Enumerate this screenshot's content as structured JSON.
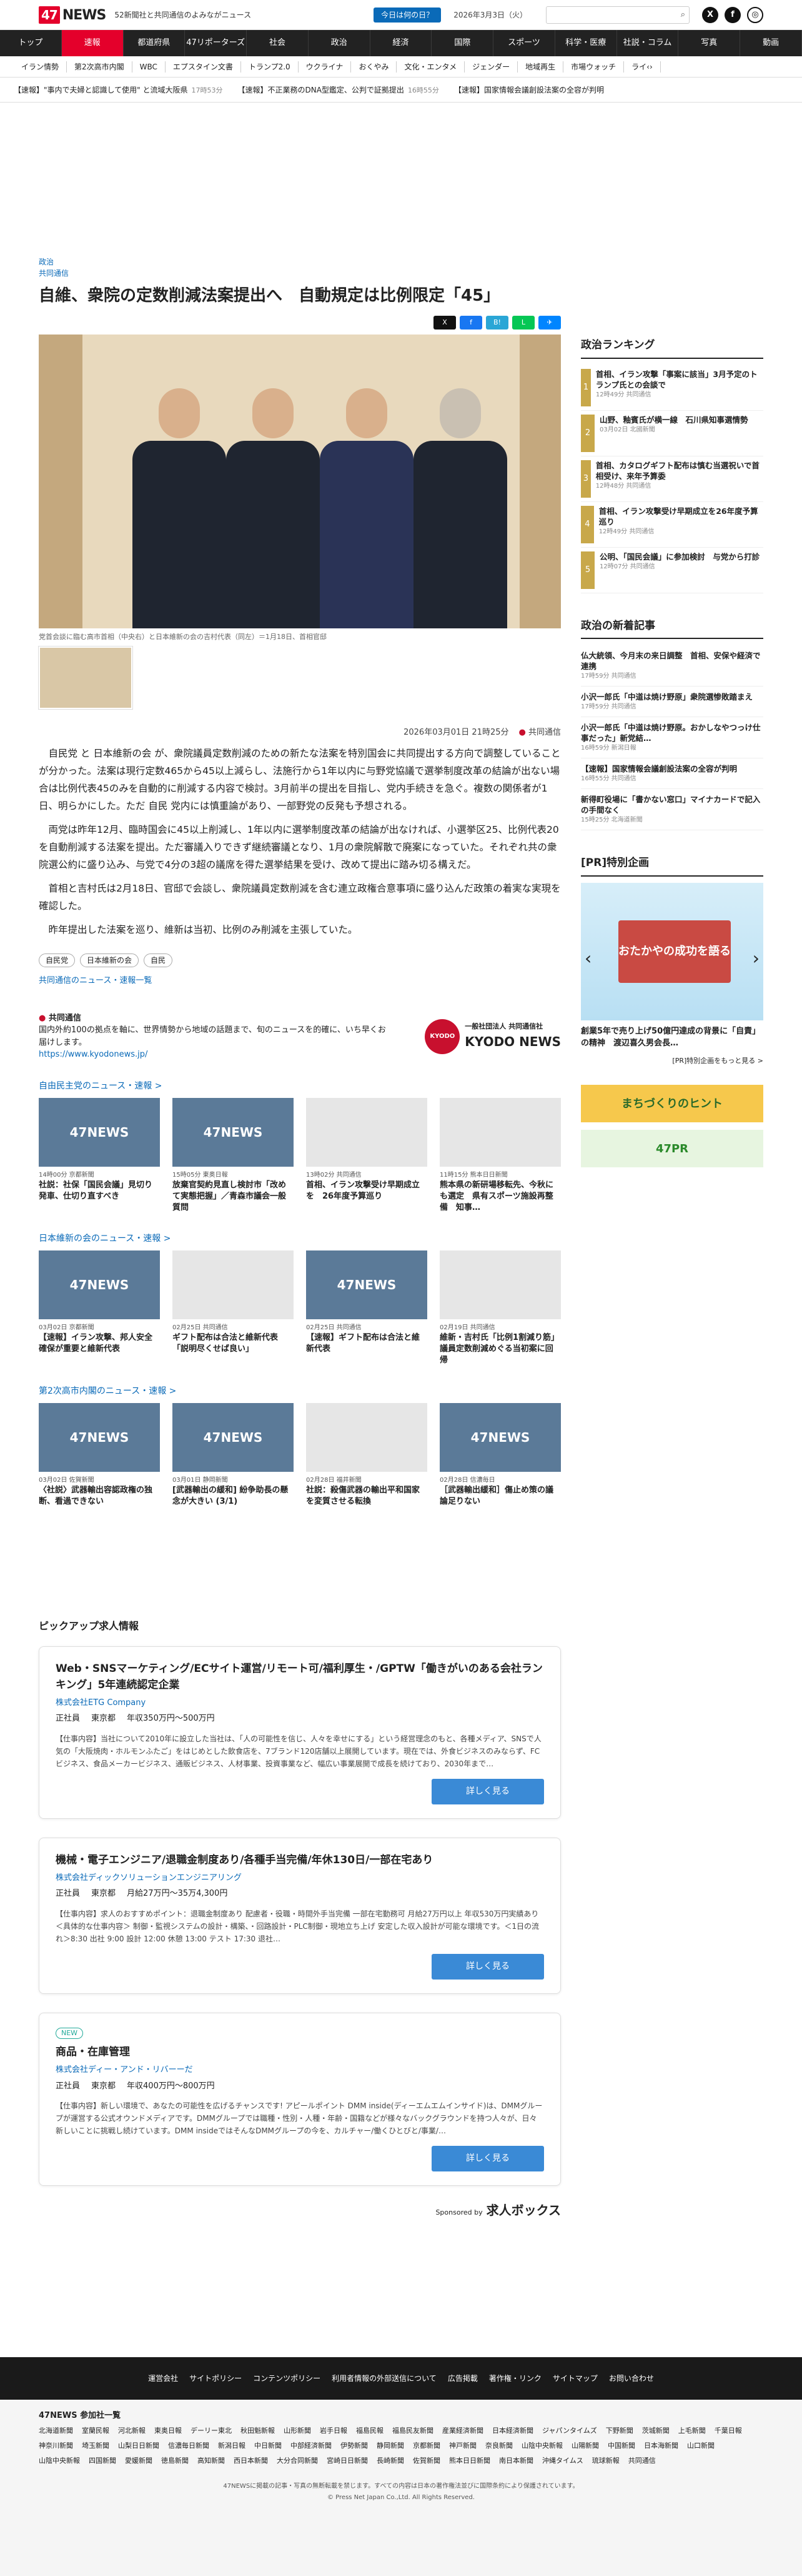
{
  "header": {
    "logo_num": "47",
    "logo_text": "NEWS",
    "tagline": "52新聞社と共同通信のよみながニュース",
    "quiz": "今日は何の日？",
    "date": "2026年3月3日（火）"
  },
  "nav": [
    "トップ",
    "速報",
    "都道府県",
    "47リポーターズ",
    "社会",
    "政治",
    "経済",
    "国際",
    "スポーツ",
    "科学・医療",
    "社説・コラム",
    "写真",
    "動画"
  ],
  "subnav": [
    "イラン情勢",
    "第2次高市内閣",
    "WBC",
    "エプスタイン文書",
    "トランプ2.0",
    "ウクライナ",
    "おくやみ",
    "文化・エンタメ",
    "ジェンダー",
    "地域再生",
    "市場ウォッチ",
    "ライ‹›"
  ],
  "ticker": [
    {
      "t": "【速報】\"事内で夫婦と認識して使用\" と流域大阪県",
      "m": "17時53分"
    },
    {
      "t": "【速報】不正業務のDNA型鑑定、公判で証拠提出",
      "m": "16時55分"
    },
    {
      "t": "【速報】国家情報会議創設法案の全容が判明",
      "m": ""
    }
  ],
  "article": {
    "cat1": "政治",
    "cat2": "共同通信",
    "title": "自維、衆院の定数削減法案提出へ　自動規定は比例限定「45」",
    "caption": "党首会談に臨む高市首相（中央右）と日本維新の会の吉村代表（同左）＝1月18日、首相官邸",
    "datetime": "2026年03月01日 21時25分",
    "source": "共同通信",
    "paras": [
      "自民党 と 日本維新の会 が、衆院議員定数削減のための新たな法案を特別国会に共同提出する方向で調整していることが分かった。法案は現行定数465から45以上減らし、法施行から1年以内に与野党協議で選挙制度改革の結論が出ない場合は比例代表45のみを自動的に削減する内容で検討。3月前半の提出を目指し、党内手続きを急ぐ。複数の関係者が1日、明らかにした。ただ 自民 党内には慎重論があり、一部野党の反発も予想される。",
      "両党は昨年12月、臨時国会に45以上削減し、1年以内に選挙制度改革の結論が出なければ、小選挙区25、比例代表20を自動削減する法案を提出。ただ審議入りできず継続審議となり、1月の衆院解散で廃案になっていた。それぞれ共の衆院選公約に盛り込み、与党で4分の3超の議席を得た選挙結果を受け、改めて提出に踏み切る構えだ。",
      "首相と吉村氏は2月18日、官邸で会談し、衆院議員定数削減を含む連立政権合意事項に盛り込んだ政策の着実な実現を確認した。",
      "昨年提出した法案を巡り、維新は当初、比例のみ削減を主張していた。"
    ],
    "tags": [
      "自民党",
      "日本維新の会",
      "自民"
    ],
    "more": "共同通信のニュース・速報一覧"
  },
  "source_box": {
    "name": "共同通信",
    "desc": "国内外約100の拠点を軸に、世界情勢から地域の話題まで、旬のニュースを的確に、いち早くお届けします。",
    "url": "https://www.kyodonews.jp/",
    "logo_small": "KYODO",
    "logo_jp": "一般社団法人 共同通信社",
    "logo_en": "KYODO NEWS"
  },
  "sections": [
    {
      "title": "自由民主党のニュース・速報 >",
      "items": [
        {
          "d": "14時00分 京都新聞",
          "t": "社説：社保「国民会議」見切り発車、仕切り直すべき",
          "img": "47NEWS"
        },
        {
          "d": "15時05分 東奥日報",
          "t": "放棄官契約見直し検討市「改めて実態把握」／青森市議会一般質問",
          "img": "47NEWS"
        },
        {
          "d": "13時02分 共同通信",
          "t": "首相、イラン攻撃受け早期成立を　26年度予算巡り",
          "img": "photo"
        },
        {
          "d": "11時15分 熊本日日新聞",
          "t": "熊本県の新研場移転先、今秋にも選定　県有スポーツ施設再整備　知事…",
          "img": "photo"
        }
      ]
    },
    {
      "title": "日本維新の会のニュース・速報 >",
      "items": [
        {
          "d": "03月02日 京都新聞",
          "t": "【速報】イラン攻撃、邦人安全確保が重要と維新代表",
          "img": "47NEWS"
        },
        {
          "d": "02月25日 共同通信",
          "t": "ギフト配布は合法と維新代表「説明尽くせば良い」",
          "img": "photo"
        },
        {
          "d": "02月25日 共同通信",
          "t": "【速報】ギフト配布は合法と維新代表",
          "img": "47NEWS"
        },
        {
          "d": "02月19日 共同通信",
          "t": "維新・吉村氏「比例1割減り筋」議員定数削減めぐる当初案に回帰",
          "img": "photo"
        }
      ]
    },
    {
      "title": "第2次高市内閣のニュース・速報 >",
      "items": [
        {
          "d": "03月02日 佐賀新聞",
          "t": "〈社説〉武器輸出容認政権の独断、看過できない",
          "img": "47NEWS"
        },
        {
          "d": "03月01日 静岡新聞",
          "t": "[武器輸出の緩和] 紛争助長の懸念が大きい (3/1)",
          "img": "47NEWS"
        },
        {
          "d": "02月28日 福井新聞",
          "t": "社説：殺傷武器の輸出平和国家を変質させる転換",
          "img": "photo"
        },
        {
          "d": "02月28日 信濃毎日",
          "t": "［武器輸出緩和］傷止め策の議論足りない",
          "img": "47NEWS"
        }
      ]
    }
  ],
  "pickup": {
    "title": "ピックアップ求人情報",
    "jobs": [
      {
        "new": "",
        "t": "Web・SNSマーケティング/ECサイト運営/リモート可/福利厚生・/GPTW「働きがいのある会社ランキング」5年連続認定企業",
        "co": "株式会社ETG Company",
        "emp": "正社員",
        "loc": "東京都",
        "sal": "年収350万円〜500万円",
        "ds": "【仕事内容】当社について2010年に設立した当社は、「人の可能性を信じ、人々を幸せにする」という経営理念のもと、各種メディア、SNSで人気の「大阪焼肉・ホルモンふたご」をはじめとした飲食店を、7ブランド120店舗以上展開しています。現在では、外食ビジネスのみならず、FCビジネス、食品メーカービジネス、通販ビジネス、人材事業、投資事業など、幅広い事業展開で成長を続けており、2030年まで…",
        "btn": "詳しく見る"
      },
      {
        "new": "",
        "t": "機械・電子エンジニア/退職金制度あり/各種手当完備/年休130日/一部在宅あり",
        "co": "株式会社ディックソリューションエンジニアリング",
        "emp": "正社員",
        "loc": "東京都",
        "sal": "月給27万円〜35万4,300円",
        "ds": "【仕事内容】求人のおすすめポイント：退職金制度あり 配慮者・役職・時間外手当完備 一部在宅勤務可 月給27万円以上 年収530万円実績あり ＜具体的な仕事内容＞ 制御・監視システムの設計・構築、・回路設計・PLC制御・現地立ち上げ 安定した収入設計が可能な環境です。＜1日の流れ＞8:30 出社 9:00 設計 12:00 休憩 13:00 テスト 17:30 退社…",
        "btn": "詳しく見る"
      },
      {
        "new": "NEW",
        "t": "商品・在庫管理",
        "co": "株式会社ディー・アンド・リバーーだ",
        "emp": "正社員",
        "loc": "東京都",
        "sal": "年収400万円〜800万円",
        "ds": "【仕事内容】新しい環境で、あなたの可能性を広げるチャンスです! アピールポイント DMM inside(ディーエムエムインサイド)は、DMMグループが運営する公式オウンドメディアです。DMMグループでは職種・性別・人種・年齢・国籍などが様々なバックグラウンドを持つ人々が、日々新しいことに挑戦し続けています。DMM insideではそんなDMMグループの今を、カルチャー/働くひとびと/事業/…",
        "btn": "詳しく見る"
      }
    ],
    "sponsor": "Sponsored by",
    "sponsor_brand": "求人ボックス"
  },
  "side": {
    "rank_title": "政治ランキング",
    "rank": [
      {
        "t": "首相、イラン攻撃「事案に該当」3月予定のトランプ氏との会談で",
        "m": "12時49分 共同通信"
      },
      {
        "t": "山野、釉賓氏が横一線　石川県知事選情勢",
        "m": "03月02日 北國新聞"
      },
      {
        "t": "首相、カタログギフト配布は慎む当選祝いで首相受け、来年予算委",
        "m": "12時48分 共同通信"
      },
      {
        "t": "首相、イラン攻撃受け早期成立を26年度予算巡り",
        "m": "12時49分 共同通信"
      },
      {
        "t": "公明、「国民会議」に参加検討　与党から打診",
        "m": "12時07分 共同通信"
      }
    ],
    "new_title": "政治の新着記事",
    "news": [
      {
        "t": "仏大統領、今月末の来日調整　首相、安保や経済で連携",
        "m": "17時59分 共同通信"
      },
      {
        "t": "小沢一郎氏「中道は焼け野原」衆院選惨敗踏まえ",
        "m": "17時59分 共同通信"
      },
      {
        "t": "小沢一郎氏「中道は焼け野原。おかしなやつっけ仕事だった」新党結…",
        "m": "16時59分 新潟日報"
      },
      {
        "t": "【速報】国家情報会議創設法案の全容が判明",
        "m": "16時55分 共同通信"
      },
      {
        "t": "新得町役場に「書かない窓口」マイナカードで記入の手間なく",
        "m": "15時25分 北海道新聞"
      }
    ],
    "pr_title": "[PR]特別企画",
    "pr_box": "おたかやの成功を語る",
    "pr_caption": "創業5年で売り上げ50億円達成の背景に「自責」の精神　渡辺喜久男会長…",
    "pr_more": "[PR]特別企画をもっと見る >",
    "ban1": "まちづくりのヒント",
    "ban2": "47PR"
  },
  "footer": {
    "links": [
      "運営会社",
      "サイトポリシー",
      "コンテンツポリシー",
      "利用者情報の外部送信について",
      "広告掲載",
      "著作権・リンク",
      "サイトマップ",
      "お問い合わせ"
    ],
    "members_title": "47NEWS 参加社一覧",
    "members": [
      "北海道新聞",
      "室蘭民報",
      "河北新報",
      "東奥日報",
      "デーリー東北",
      "秋田魁新報",
      "山形新聞",
      "岩手日報",
      "福島民報",
      "福島民友新聞",
      "産業経済新聞",
      "日本経済新聞",
      "ジャパンタイムズ",
      "下野新聞",
      "茨城新聞",
      "上毛新聞",
      "千葉日報",
      "神奈川新聞",
      "埼玉新聞",
      "山梨日日新聞",
      "信濃毎日新聞",
      "新潟日報",
      "中日新聞",
      "中部経済新聞",
      "伊勢新聞",
      "静岡新聞",
      "京都新聞",
      "神戸新聞",
      "奈良新聞",
      "山陰中央新報",
      "山陽新聞",
      "中国新聞",
      "日本海新聞",
      "山口新聞",
      "山陰中央新報",
      "四国新聞",
      "愛媛新聞",
      "徳島新聞",
      "高知新聞",
      "西日本新聞",
      "大分合同新聞",
      "宮崎日日新聞",
      "長崎新聞",
      "佐賀新聞",
      "熊本日日新聞",
      "南日本新聞",
      "沖縄タイムス",
      "琉球新報",
      "共同通信"
    ],
    "copy1": "47NEWSに掲載の記事・写真の無断転載を禁じます。すべての内容は日本の著作権法並びに国際条約により保護されています。",
    "copy2": "© Press Net Japan Co.,Ltd. All Rights Reserved."
  }
}
